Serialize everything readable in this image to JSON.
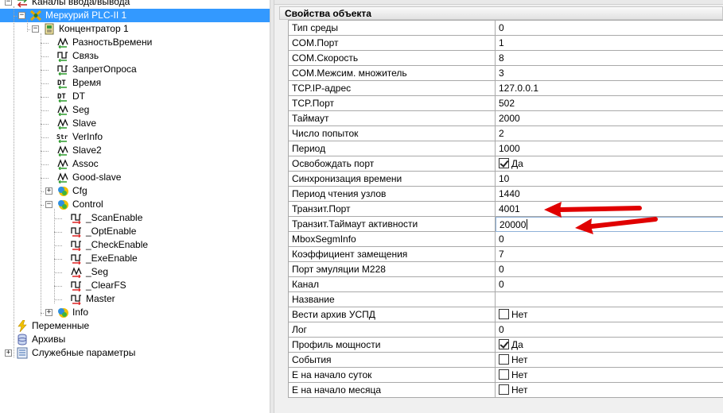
{
  "tree": {
    "items": [
      {
        "label": "Каналы ввода/вывода",
        "icon": "io-channels-icon",
        "expander": "⊟",
        "selected": false
      },
      {
        "label": "Меркурий PLC-II 1",
        "icon": "mercury-device-icon",
        "expander": "⊟",
        "selected": true
      },
      {
        "label": "Концентратор 1",
        "icon": "concentrator-icon",
        "expander": "⊟",
        "selected": false
      },
      {
        "label": "РазностьВремени",
        "icon": "analog-signal-icon",
        "selected": false
      },
      {
        "label": "Связь",
        "icon": "discrete-signal-icon",
        "selected": false
      },
      {
        "label": "ЗапретОпроса",
        "icon": "discrete-signal-icon",
        "selected": false
      },
      {
        "label": "Время",
        "icon": "datetime-signal-icon",
        "selected": false
      },
      {
        "label": "DT",
        "icon": "datetime-signal-icon",
        "selected": false
      },
      {
        "label": "Seg",
        "icon": "analog-signal-icon",
        "selected": false
      },
      {
        "label": "Slave",
        "icon": "analog-signal-icon",
        "selected": false
      },
      {
        "label": "VerInfo",
        "icon": "string-signal-icon",
        "selected": false
      },
      {
        "label": "Slave2",
        "icon": "analog-signal-icon",
        "selected": false
      },
      {
        "label": "Assoc",
        "icon": "analog-signal-icon",
        "selected": false
      },
      {
        "label": "Good-slave",
        "icon": "analog-signal-icon",
        "selected": false
      },
      {
        "label": "Cfg",
        "icon": "group-folder-icon",
        "expander": "⊞",
        "selected": false
      },
      {
        "label": "Control",
        "icon": "group-folder-icon",
        "expander": "⊟",
        "selected": false
      },
      {
        "label": "_ScanEnable",
        "icon": "discrete-output-icon",
        "selected": false
      },
      {
        "label": "_OptEnable",
        "icon": "discrete-output-icon",
        "selected": false
      },
      {
        "label": "_CheckEnable",
        "icon": "discrete-output-icon",
        "selected": false
      },
      {
        "label": "_ExeEnable",
        "icon": "discrete-output-icon",
        "selected": false
      },
      {
        "label": "_Seg",
        "icon": "analog-output-icon",
        "selected": false
      },
      {
        "label": "_ClearFS",
        "icon": "discrete-output-icon",
        "selected": false
      },
      {
        "label": "Master",
        "icon": "discrete-output-icon",
        "selected": false
      },
      {
        "label": "Info",
        "icon": "group-folder-icon",
        "expander": "⊞",
        "selected": false
      },
      {
        "label": "Переменные",
        "icon": "lightning-icon",
        "selected": false
      },
      {
        "label": "Архивы",
        "icon": "database-icon",
        "selected": false
      },
      {
        "label": "Служебные параметры",
        "icon": "service-params-icon",
        "expander": "⊞",
        "selected": false
      }
    ]
  },
  "properties": {
    "title": "Свойства объекта",
    "rows": [
      {
        "name": "Тип среды",
        "value": "0"
      },
      {
        "name": "COM.Порт",
        "value": "1"
      },
      {
        "name": "COM.Скорость",
        "value": "8"
      },
      {
        "name": "COM.Межсим. множитель",
        "value": "3"
      },
      {
        "name": "TCP.IP-адрес",
        "value": "127.0.0.1"
      },
      {
        "name": "TCP.Порт",
        "value": "502"
      },
      {
        "name": "Таймаут",
        "value": "2000"
      },
      {
        "name": "Число попыток",
        "value": "2"
      },
      {
        "name": "Период",
        "value": "1000"
      },
      {
        "name": "Освобождать порт",
        "value": "Да",
        "checkbox": true,
        "checked": true
      },
      {
        "name": "Синхронизация времени",
        "value": "10"
      },
      {
        "name": "Период чтения узлов",
        "value": "1440"
      },
      {
        "name": "Транзит.Порт",
        "value": "4001"
      },
      {
        "name": "Транзит.Таймаут активности",
        "value": "20000",
        "editing": true
      },
      {
        "name": "MboxSegmInfo",
        "value": "0"
      },
      {
        "name": "Коэффициент замещения",
        "value": "7"
      },
      {
        "name": "Порт эмуляции M228",
        "value": "0"
      },
      {
        "name": "Канал",
        "value": "0"
      },
      {
        "name": "Название",
        "value": ""
      },
      {
        "name": "Вести архив УСПД",
        "value": "Нет",
        "checkbox": true,
        "checked": false
      },
      {
        "name": "Лог",
        "value": "0"
      },
      {
        "name": "Профиль мощности",
        "value": "Да",
        "checkbox": true,
        "checked": true
      },
      {
        "name": "События",
        "value": "Нет",
        "checkbox": true,
        "checked": false
      },
      {
        "name": "Е на начало суток",
        "value": "Нет",
        "checkbox": true,
        "checked": false
      },
      {
        "name": "Е на начало месяца",
        "value": "Нет",
        "checkbox": true,
        "checked": false
      }
    ]
  },
  "colors": {
    "selection": "#3399ff",
    "annotation_arrow": "#e00000"
  }
}
